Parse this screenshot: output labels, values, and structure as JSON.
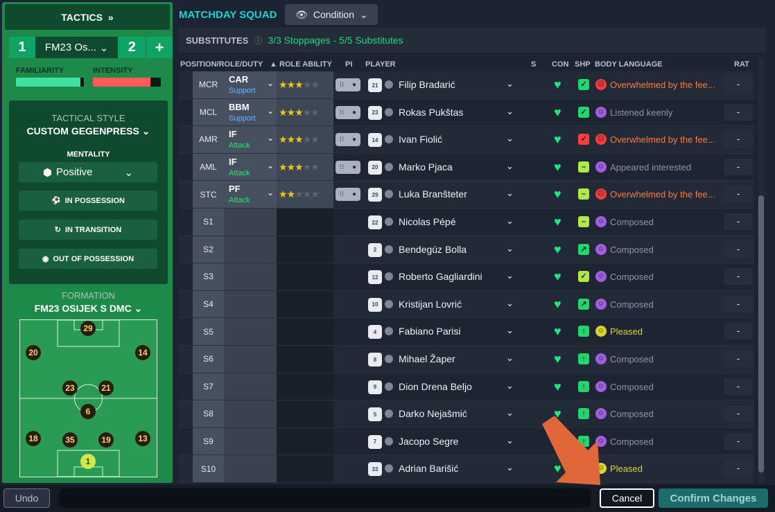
{
  "tactics": {
    "header": "TACTICS",
    "slot1": "1",
    "name": "FM23 Os...",
    "slot2": "2",
    "add": "+",
    "familiarity_label": "FAMILIARITY",
    "familiarity_value": 0.95,
    "intensity_label": "INTENSITY",
    "intensity_value": 0.85,
    "style_label": "TACTICAL STYLE",
    "style_value": "CUSTOM GEGENPRESS",
    "mentality_label": "MENTALITY",
    "mentality_value": "Positive",
    "in_possession": "IN POSSESSION",
    "in_transition": "IN TRANSITION",
    "out_of_possession": "OUT OF POSSESSION",
    "formation_label": "FORMATION",
    "formation_value": "FM23 OSIJEK S DMC",
    "pitch_players": [
      "29",
      "20",
      "14",
      "23",
      "21",
      "6",
      "18",
      "35",
      "19",
      "13",
      "1"
    ]
  },
  "main": {
    "title": "MATCHDAY SQUAD",
    "condition_button": "Condition",
    "subs_label": "SUBSTITUTES",
    "subs_info": "3/3 Stoppages - 5/5 Substitutes",
    "columns": {
      "position": "POSITION/ROLE/DUTY",
      "ability": "ROLE ABILITY",
      "pi": "PI",
      "player": "PLAYER",
      "s": "S",
      "con": "CON",
      "shp": "SHP",
      "body": "BODY LANGUAGE",
      "rat": "RAT"
    },
    "rows": [
      {
        "pos": "MCR",
        "role": "CAR",
        "duty": "Support",
        "stars": 2.5,
        "num": "21",
        "name": "Filip Bradarić",
        "shp": "✓",
        "shp_color": "#21d66b",
        "bl_face": "☹",
        "bl_face_color": "#ff3b3b",
        "bl": "Overwhelmed by the fee...",
        "bl_color": "#ff7a3a",
        "rat": "-"
      },
      {
        "pos": "MCL",
        "role": "BBM",
        "duty": "Support",
        "stars": 2.5,
        "num": "23",
        "name": "Rokas Pukštas",
        "shp": "✓",
        "shp_color": "#21d66b",
        "bl_face": "☺",
        "bl_face_color": "#a15ee0",
        "bl": "Listened keenly",
        "bl_color": "#8d96a5",
        "rat": "-"
      },
      {
        "pos": "AMR",
        "role": "IF",
        "duty": "Attack",
        "stars": 2.5,
        "num": "14",
        "name": "Ivan Fiolić",
        "shp": "✓",
        "shp_color": "#ff3b3b",
        "bl_face": "☹",
        "bl_face_color": "#ff3b3b",
        "bl": "Overwhelmed by the fee...",
        "bl_color": "#ff7a3a",
        "rat": "-"
      },
      {
        "pos": "AML",
        "role": "IF",
        "duty": "Attack",
        "stars": 2.5,
        "num": "20",
        "name": "Marko Pjaca",
        "shp": "–",
        "shp_color": "#aee84a",
        "bl_face": "☺",
        "bl_face_color": "#a15ee0",
        "bl": "Appeared interested",
        "bl_color": "#8d96a5",
        "rat": "-"
      },
      {
        "pos": "STC",
        "role": "PF",
        "duty": "Attack",
        "stars": 2,
        "num": "29",
        "name": "Luka Branšteter",
        "shp": "–",
        "shp_color": "#aee84a",
        "bl_face": "☹",
        "bl_face_color": "#ff3b3b",
        "bl": "Overwhelmed by the fee...",
        "bl_color": "#ff7a3a",
        "rat": "-"
      },
      {
        "pos": "S1",
        "num": "22",
        "name": "Nicolas Pépé",
        "shp": "–",
        "shp_color": "#aee84a",
        "bl_face": "☺",
        "bl_face_color": "#a15ee0",
        "bl": "Composed",
        "bl_color": "#8d96a5",
        "rat": "-"
      },
      {
        "pos": "S2",
        "num": "2",
        "name": "Bendegúz Bolla",
        "shp": "↗",
        "shp_color": "#21d66b",
        "bl_face": "☺",
        "bl_face_color": "#a15ee0",
        "bl": "Composed",
        "bl_color": "#8d96a5",
        "rat": "-"
      },
      {
        "pos": "S3",
        "num": "12",
        "name": "Roberto Gagliardini",
        "shp": "✓",
        "shp_color": "#aee84a",
        "bl_face": "☺",
        "bl_face_color": "#a15ee0",
        "bl": "Composed",
        "bl_color": "#8d96a5",
        "rat": "-"
      },
      {
        "pos": "S4",
        "num": "10",
        "name": "Kristijan Lovrić",
        "shp": "↗",
        "shp_color": "#21d66b",
        "bl_face": "☺",
        "bl_face_color": "#a15ee0",
        "bl": "Composed",
        "bl_color": "#8d96a5",
        "rat": "-"
      },
      {
        "pos": "S5",
        "num": "4",
        "name": "Fabiano Parisi",
        "shp": "↑",
        "shp_color": "#21d66b",
        "bl_face": "☺",
        "bl_face_color": "#d8d62a",
        "bl": "Pleased",
        "bl_color": "#d8d62a",
        "rat": "-"
      },
      {
        "pos": "S6",
        "num": "8",
        "name": "Mihael Žaper",
        "shp": "↑",
        "shp_color": "#21d66b",
        "bl_face": "☺",
        "bl_face_color": "#a15ee0",
        "bl": "Composed",
        "bl_color": "#8d96a5",
        "rat": "-"
      },
      {
        "pos": "S7",
        "num": "9",
        "name": "Dion Drena Beljo",
        "shp": "↑",
        "shp_color": "#21d66b",
        "bl_face": "☺",
        "bl_face_color": "#a15ee0",
        "bl": "Composed",
        "bl_color": "#8d96a5",
        "rat": "-"
      },
      {
        "pos": "S8",
        "num": "5",
        "name": "Darko Nejašmić",
        "shp": "↑",
        "shp_color": "#21d66b",
        "bl_face": "☺",
        "bl_face_color": "#a15ee0",
        "bl": "Composed",
        "bl_color": "#8d96a5",
        "rat": "-"
      },
      {
        "pos": "S9",
        "num": "7",
        "name": "Jacopo Segre",
        "shp": "↑",
        "shp_color": "#21d66b",
        "bl_face": "☺",
        "bl_face_color": "#a15ee0",
        "bl": "Composed",
        "bl_color": "#8d96a5",
        "rat": "-"
      },
      {
        "pos": "S10",
        "num": "33",
        "name": "Adrian Barišić",
        "shp": "↑",
        "shp_color": "#21d66b",
        "bl_face": "☺",
        "bl_face_color": "#d8d62a",
        "bl": "Pleased",
        "bl_color": "#d8d62a",
        "rat": "-"
      }
    ]
  },
  "bottom": {
    "undo": "Undo",
    "cancel": "Cancel",
    "confirm": "Confirm Changes"
  },
  "colors": {
    "accent": "#1fd2d2",
    "green_panel": "#1e8a4a",
    "arrow": "#e0673a"
  }
}
